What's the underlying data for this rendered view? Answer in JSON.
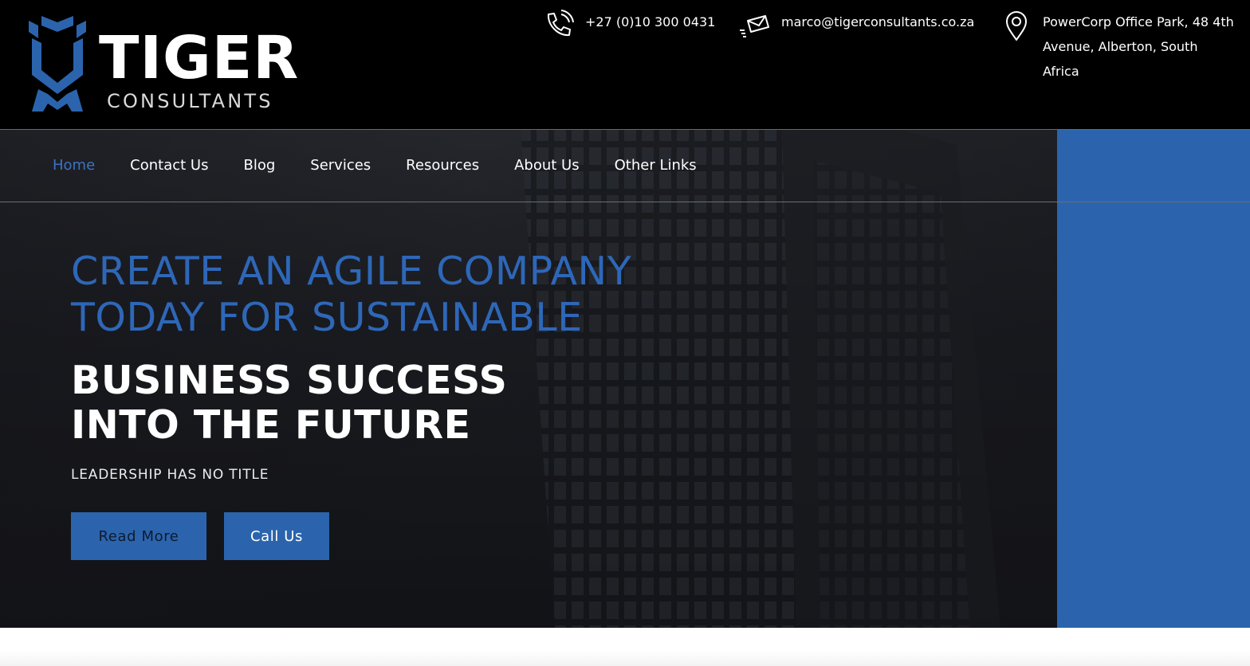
{
  "brand": {
    "name": "TIGER",
    "sub": "CONSULTANTS",
    "accent": "#2b64ad"
  },
  "contact": {
    "phone": {
      "icon": "phone-icon",
      "text": "+27 (0)10 300 0431"
    },
    "email": {
      "icon": "mail-icon",
      "text": "marco@tigerconsultants.co.za"
    },
    "address": {
      "icon": "location-pin-icon",
      "line1": "PowerCorp Office Park, 48 4th",
      "line2": "Avenue, Alberton, South Africa"
    }
  },
  "nav": {
    "items": [
      {
        "label": "Home",
        "active": true
      },
      {
        "label": "Contact Us",
        "active": false
      },
      {
        "label": "Blog",
        "active": false
      },
      {
        "label": "Services",
        "active": false
      },
      {
        "label": "Resources",
        "active": false
      },
      {
        "label": "About Us",
        "active": false
      },
      {
        "label": "Other Links",
        "active": false
      }
    ]
  },
  "hero": {
    "headline_blue_1": "CREATE AN AGILE COMPANY",
    "headline_blue_2": "TODAY FOR SUSTAINABLE",
    "headline_white_1": "BUSINESS SUCCESS",
    "headline_white_2": "INTO THE FUTURE",
    "tagline": "LEADERSHIP HAS NO TITLE",
    "buttons": {
      "read_more": "Read More",
      "call_us": "Call Us"
    }
  },
  "colors": {
    "nav_active": "#3b73c4",
    "headline_blue": "#2e67b8",
    "button": "#2b64ad",
    "side_panel": "#2b64ad"
  }
}
